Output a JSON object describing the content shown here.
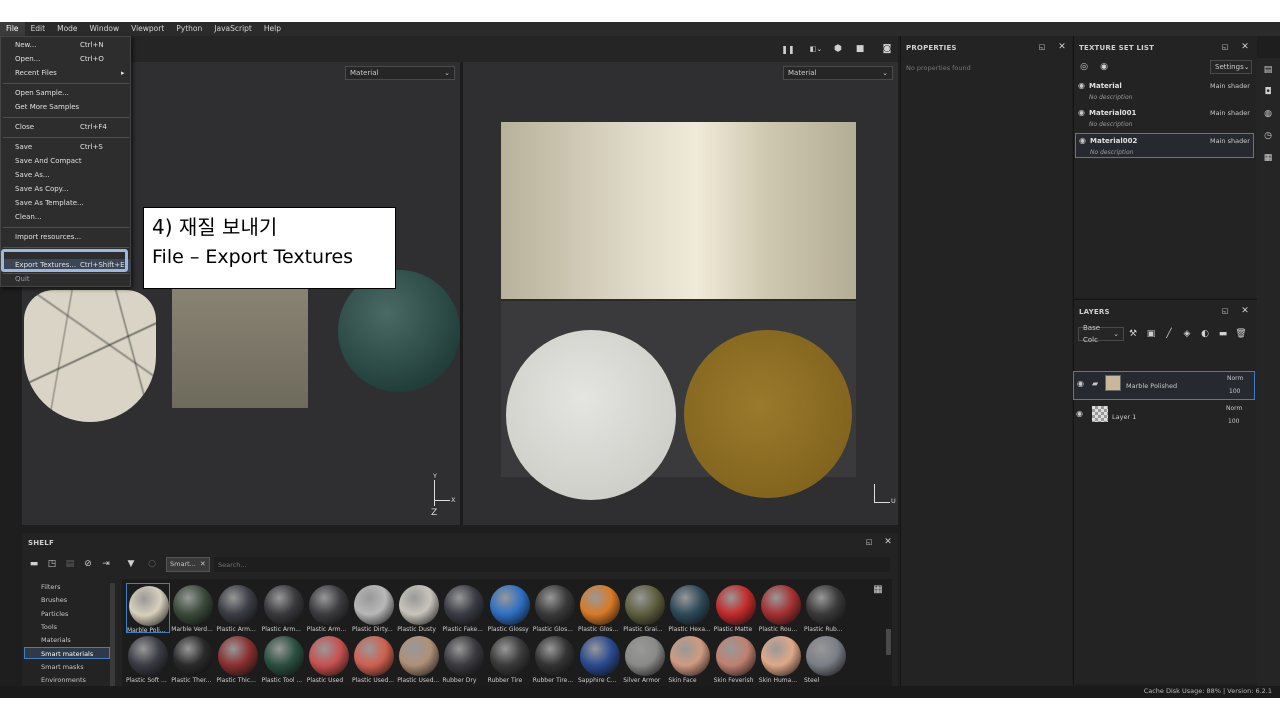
{
  "menubar": {
    "items": [
      "File",
      "Edit",
      "Mode",
      "Window",
      "Viewport",
      "Python",
      "JavaScript",
      "Help"
    ]
  },
  "file_menu": {
    "items": [
      {
        "label": "New...",
        "shortcut": "Ctrl+N"
      },
      {
        "label": "Open...",
        "shortcut": "Ctrl+O"
      },
      {
        "label": "Recent Files",
        "shortcut": ""
      },
      {
        "label": "Open Sample...",
        "shortcut": ""
      },
      {
        "label": "Get More Samples",
        "shortcut": ""
      },
      {
        "label": "Close",
        "shortcut": "Ctrl+F4"
      },
      {
        "label": "Save",
        "shortcut": "Ctrl+S"
      },
      {
        "label": "Save And Compact",
        "shortcut": ""
      },
      {
        "label": "Save As...",
        "shortcut": ""
      },
      {
        "label": "Save As Copy...",
        "shortcut": ""
      },
      {
        "label": "Save As Template...",
        "shortcut": ""
      },
      {
        "label": "Clean...",
        "shortcut": ""
      },
      {
        "label": "Import resources...",
        "shortcut": ""
      },
      {
        "label": "Export Textures...",
        "shortcut": "Ctrl+Shift+E"
      },
      {
        "label": "Quit",
        "shortcut": ""
      }
    ]
  },
  "annotation": {
    "line1": "4) 재질 보내기",
    "line2": "File – Export Textures"
  },
  "viewport3d": {
    "dropdown": "Material"
  },
  "viewport2d": {
    "dropdown": "Material",
    "axis_u": "U"
  },
  "axes3d": {
    "y": "Y",
    "x": "X",
    "z": "Z"
  },
  "properties": {
    "title": "PROPERTIES",
    "empty": "No properties found"
  },
  "texture_set_list": {
    "title": "TEXTURE SET LIST",
    "settings": "Settings",
    "items": [
      {
        "name": "Material",
        "shader": "Main shader",
        "desc": "No description"
      },
      {
        "name": "Material001",
        "shader": "Main shader",
        "desc": "No description"
      },
      {
        "name": "Material002",
        "shader": "Main shader",
        "desc": "No description"
      }
    ]
  },
  "layers": {
    "title": "LAYERS",
    "channel": "Base Colc",
    "items": [
      {
        "name": "Marble Polished",
        "blend": "Norm",
        "opacity": "100"
      },
      {
        "name": "Layer 1",
        "blend": "Norm",
        "opacity": "100"
      }
    ]
  },
  "shelf": {
    "title": "SHELF",
    "filter_tag": "Smart...",
    "search_placeholder": "Search...",
    "categories": [
      "Filters",
      "Brushes",
      "Particles",
      "Tools",
      "Materials",
      "Smart materials",
      "Smart masks",
      "Environments"
    ],
    "selected_category": "Smart materials",
    "row1": [
      "Marble Poli...",
      "Marble Verd...",
      "Plastic Arm...",
      "Plastic Arm...",
      "Plastic Arm...",
      "Plastic Dirty...",
      "Plastic Dusty",
      "Plastic Fake...",
      "Plastic Glossy",
      "Plastic Glos...",
      "Plastic Glos...",
      "Plastic Grai...",
      "Plastic Hexa...",
      "Plastic Matte",
      "Plastic Rou...",
      "Plastic Rub..."
    ],
    "row2": [
      "Plastic Soft ...",
      "Plastic Ther...",
      "Plastic Thic...",
      "Plastic Tool ...",
      "Plastic Used",
      "Plastic Used...",
      "Plastic Used...",
      "Rubber Dry",
      "Rubber Tire",
      "Rubber Tire...",
      "Sapphire C...",
      "Silver Armor",
      "Skin Face",
      "Skin Feverish",
      "Skin Huma...",
      "Steel"
    ],
    "row1_colors": [
      "#d8d0bc",
      "#3a4a3a",
      "#3b3d45",
      "#3a3a3e",
      "#3c3c40",
      "#b8b8b8",
      "#c8c4bc",
      "#3a3c44",
      "#2d6fc4",
      "#3a3a3a",
      "#d97a26",
      "#5e5e3e",
      "#2e4a5a",
      "#c42a2a",
      "#a63030",
      "#3a3a3a"
    ],
    "row2_colors": [
      "#3a3c44",
      "#2a2a2a",
      "#8a3030",
      "#2a5040",
      "#c85050",
      "#d06050",
      "#b09078",
      "#3a3a40",
      "#3a3a3a",
      "#333333",
      "#2a4a90",
      "#8a8a88",
      "#d09a80",
      "#c08070",
      "#e0a888",
      "#7a7e86"
    ]
  },
  "status": {
    "text": "Cache Disk Usage:   88% | Version: 6.2.1"
  }
}
